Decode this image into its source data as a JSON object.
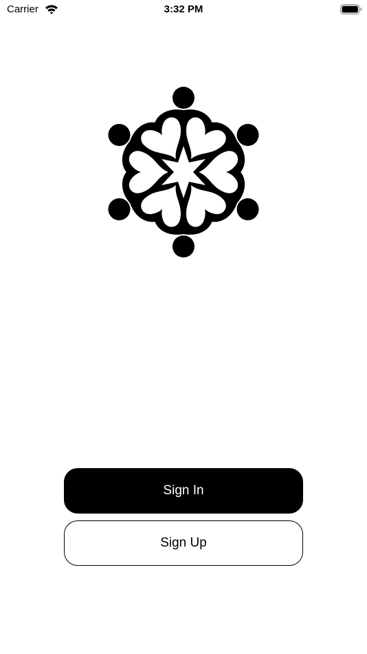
{
  "status_bar": {
    "carrier": "Carrier",
    "time": "3:32 PM",
    "wifi_icon": "wifi-icon",
    "battery_icon": "battery-full-icon"
  },
  "logo": {
    "icon": "community-circle-logo-icon"
  },
  "actions": {
    "sign_in_label": "Sign In",
    "sign_up_label": "Sign Up"
  },
  "colors": {
    "primary": "#000000",
    "background": "#ffffff"
  }
}
